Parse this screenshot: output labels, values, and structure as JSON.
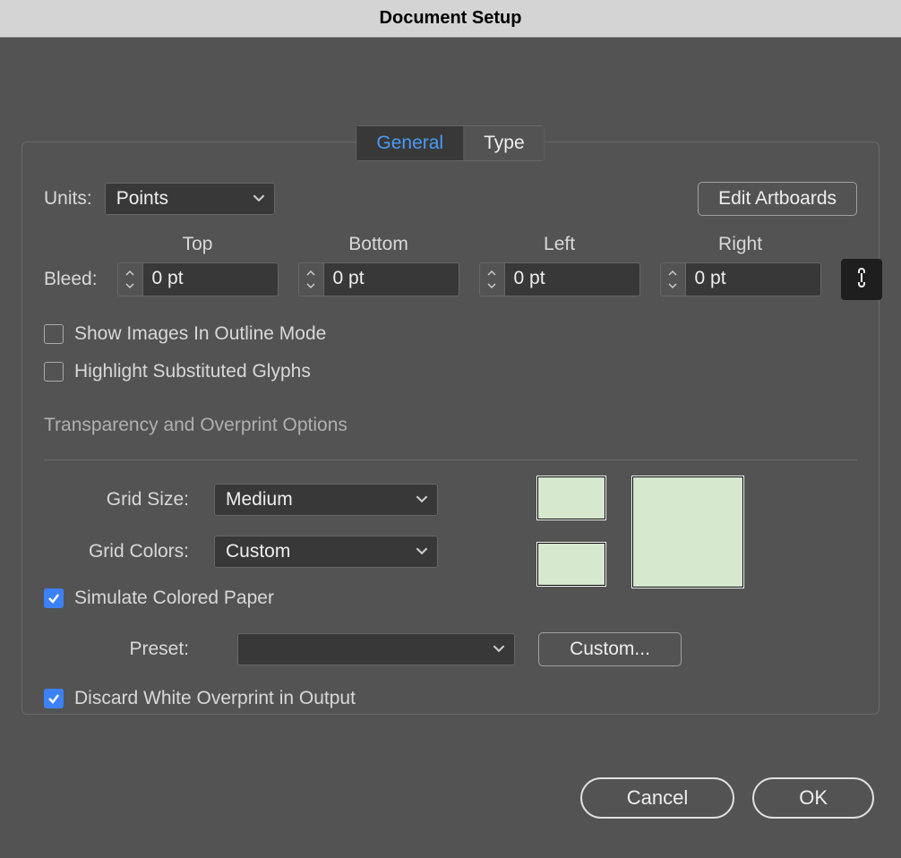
{
  "title": "Document Setup",
  "tabs": {
    "general": "General",
    "type": "Type",
    "active": "general"
  },
  "units": {
    "label": "Units:",
    "value": "Points"
  },
  "edit_artboards": "Edit Artboards",
  "bleed": {
    "label": "Bleed:",
    "cols": {
      "top": "Top",
      "bottom": "Bottom",
      "left": "Left",
      "right": "Right"
    },
    "values": {
      "top": "0 pt",
      "bottom": "0 pt",
      "left": "0 pt",
      "right": "0 pt"
    },
    "linked": true
  },
  "check_outline": {
    "label": "Show Images In Outline Mode",
    "checked": false
  },
  "check_glyphs": {
    "label": "Highlight Substituted Glyphs",
    "checked": false
  },
  "section_transparency": "Transparency and Overprint Options",
  "grid_size": {
    "label": "Grid Size:",
    "value": "Medium"
  },
  "grid_colors": {
    "label": "Grid Colors:",
    "value": "Custom"
  },
  "simulate_paper": {
    "label": "Simulate Colored Paper",
    "checked": true
  },
  "preset": {
    "label": "Preset:",
    "value": "",
    "custom_btn": "Custom..."
  },
  "discard_white": {
    "label": "Discard White Overprint in Output",
    "checked": true
  },
  "swatch_color": "#d6e8ce",
  "buttons": {
    "cancel": "Cancel",
    "ok": "OK"
  }
}
